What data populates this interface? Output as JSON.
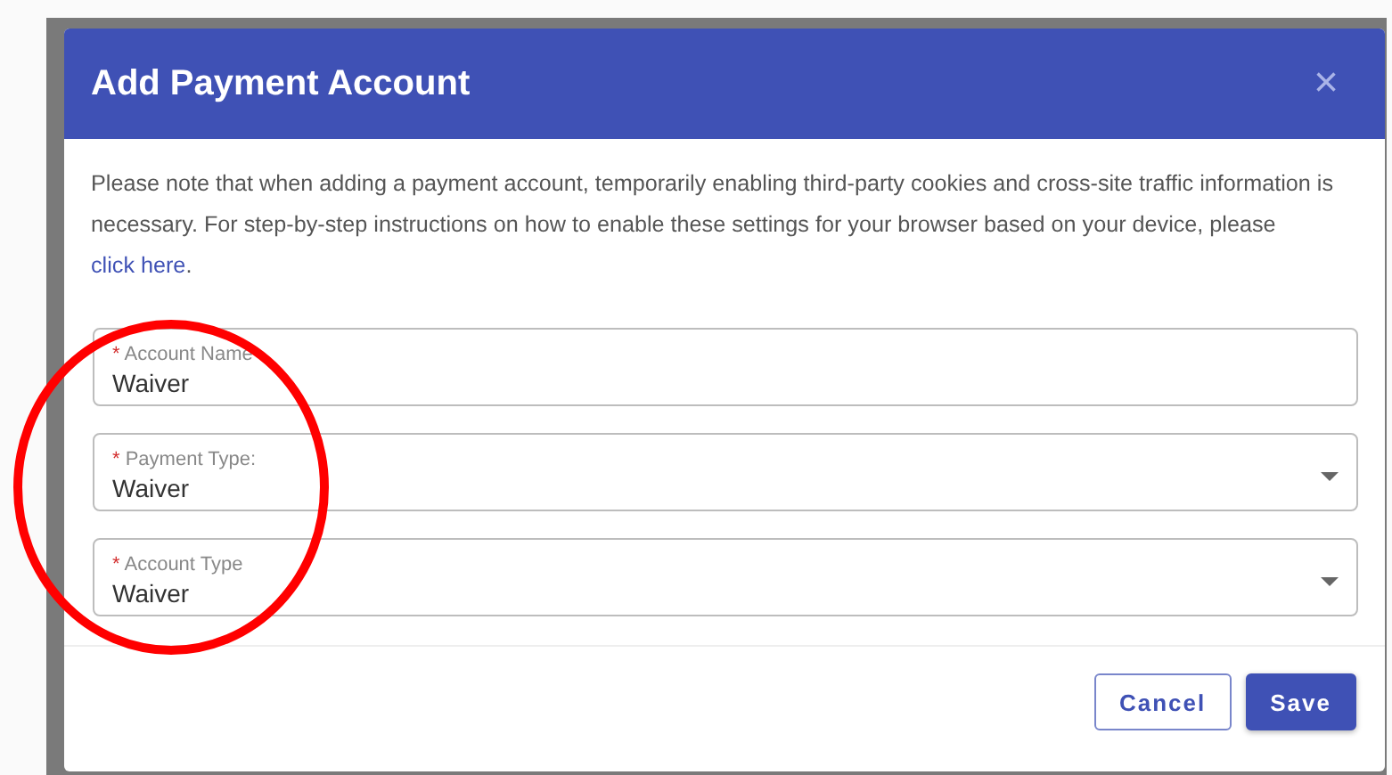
{
  "dialog": {
    "title": "Add Payment Account",
    "close": "×",
    "notice": {
      "text": "Please note that when adding a payment account, temporarily enabling third-party cookies and cross-site traffic information is necessary. For step-by-step instructions on how to enable these settings for your browser based on your device, please ",
      "link": "click here",
      "after": "."
    },
    "fields": [
      {
        "kind": "text",
        "required_mark": "*",
        "label": "Account Name",
        "value": "Waiver"
      },
      {
        "kind": "select",
        "required_mark": "*",
        "label": "Payment Type:",
        "value": "Waiver"
      },
      {
        "kind": "select",
        "required_mark": "*",
        "label": "Account Type",
        "value": "Waiver"
      }
    ],
    "buttons": [
      {
        "kind": "secondary",
        "label": "Cancel"
      },
      {
        "kind": "primary",
        "label": "Save"
      }
    ]
  },
  "annotation_circle": true
}
